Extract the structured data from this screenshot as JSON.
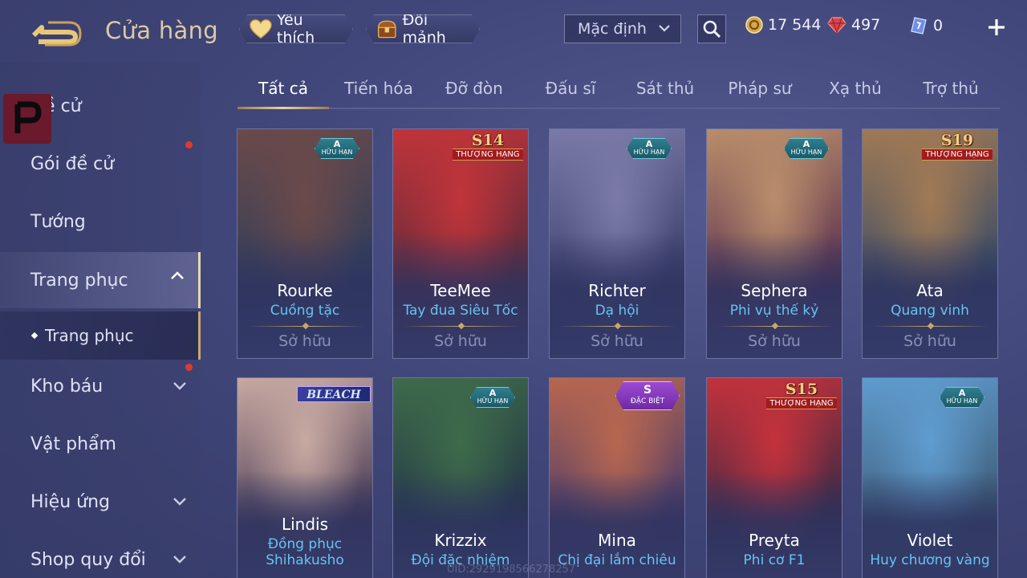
{
  "header": {
    "title": "Cửa hàng",
    "favorites_label": "Yêu thích",
    "fragments_label": "Đổi mảnh",
    "sort_value": "Mặc định",
    "currency": {
      "gold": "17 544",
      "ruby": "497",
      "voucher": "0"
    }
  },
  "sidebar": {
    "items": [
      {
        "label": "Đề cử"
      },
      {
        "label": "Gói đề cử"
      },
      {
        "label": "Tướng"
      },
      {
        "label": "Trang phục"
      },
      {
        "label": "Trang phục"
      },
      {
        "label": "Kho báu"
      },
      {
        "label": "Vật phẩm"
      },
      {
        "label": "Hiệu ứng"
      },
      {
        "label": "Shop quy đổi"
      }
    ]
  },
  "tabs": [
    "Tất cả",
    "Tiến hóa",
    "Đỡ đòn",
    "Đấu sĩ",
    "Sát thủ",
    "Pháp sư",
    "Xạ thủ",
    "Trợ thủ"
  ],
  "cards": [
    {
      "hero": "Rourke",
      "skin": "Cuồng tặc",
      "status": "Sở hữu",
      "badge": "A",
      "badge_sub": "HỮU HẠN",
      "colors": [
        "#6b4a4a",
        "#2c3d5c"
      ]
    },
    {
      "hero": "TeeMee",
      "skin": "Tay đua Siêu Tốc",
      "status": "Sở hữu",
      "badge": "S14",
      "badge_sub": "THƯỢNG HẠNG",
      "colors": [
        "#c0343a",
        "#5a2a3a"
      ]
    },
    {
      "hero": "Richter",
      "skin": "Dạ hội",
      "status": "Sở hữu",
      "badge": "A",
      "badge_sub": "HỮU HẠN",
      "colors": [
        "#7b7aa8",
        "#3a3e6c"
      ]
    },
    {
      "hero": "Sephera",
      "skin": "Phi vụ thế kỷ",
      "status": "Sở hữu",
      "badge": "A",
      "badge_sub": "HỮU HẠN",
      "colors": [
        "#b98d6a",
        "#5a3050"
      ]
    },
    {
      "hero": "Ata",
      "skin": "Quang vinh",
      "status": "Sở hữu",
      "badge": "S19",
      "badge_sub": "THƯỢNG HẠNG",
      "colors": [
        "#a07a55",
        "#354a66"
      ]
    },
    {
      "hero": "Lindis",
      "skin": "Đồng phục Shihakusho",
      "status": "",
      "badge": "BLEACH",
      "badge_sub": "",
      "colors": [
        "#c8a9a2",
        "#4a3c55"
      ]
    },
    {
      "hero": "Krizzix",
      "skin": "Đội đặc nhiệm",
      "status": "",
      "badge": "A",
      "badge_sub": "HỮU HẠN",
      "colors": [
        "#3e6b4a",
        "#223447"
      ]
    },
    {
      "hero": "Mina",
      "skin": "Chị đại lắm chiêu",
      "status": "",
      "badge": "S",
      "badge_sub": "ĐẶC BIỆT",
      "colors": [
        "#b8674f",
        "#4a3b6a"
      ]
    },
    {
      "hero": "Preyta",
      "skin": "Phi cơ F1",
      "status": "",
      "badge": "S15",
      "badge_sub": "THƯỢNG HẠNG",
      "colors": [
        "#c4323c",
        "#3a2944"
      ]
    },
    {
      "hero": "Violet",
      "skin": "Huy chương vàng",
      "status": "",
      "badge": "A",
      "badge_sub": "HỮU HẠN",
      "colors": [
        "#5f9ccf",
        "#3d5a73"
      ]
    }
  ],
  "watermark_uid": "UID:2929198566278257",
  "accent": {
    "gold": "#ddc9a4",
    "skin_blue": "#66c4f0",
    "alert_red": "#e0392f"
  }
}
